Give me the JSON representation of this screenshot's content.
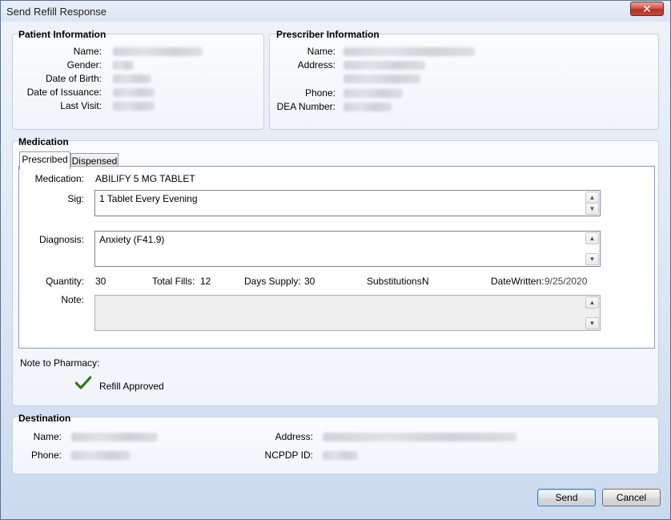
{
  "window": {
    "title": "Send Refill Response",
    "close_glyph": "✕"
  },
  "patient": {
    "section_title": "Patient Information",
    "labels": {
      "name": "Name:",
      "gender": "Gender:",
      "dob": "Date of Birth:",
      "issuance": "Date of Issuance:",
      "last_visit": "Last Visit:"
    }
  },
  "prescriber": {
    "section_title": "Prescriber Information",
    "labels": {
      "name": "Name:",
      "address": "Address:",
      "phone": "Phone:",
      "dea": "DEA Number:"
    }
  },
  "medication": {
    "section_title": "Medication",
    "tabs": [
      "Prescribed",
      "Dispensed"
    ],
    "active_tab": "Prescribed",
    "labels": {
      "medication": "Medication:",
      "sig": "Sig:",
      "diagnosis": "Diagnosis:",
      "quantity": "Quantity:",
      "total_fills": "Total Fills:",
      "days_supply": "Days Supply:",
      "substitutions": "Substitutions:",
      "date_written": "DateWritten:",
      "note": "Note:"
    },
    "values": {
      "medication": "ABILIFY 5 MG TABLET",
      "sig": "1 Tablet Every Evening",
      "diagnosis": "Anxiety (F41.9)",
      "quantity": "30",
      "total_fills": "12",
      "days_supply": "30",
      "substitutions": "N",
      "date_written": "9/25/2020",
      "note": ""
    }
  },
  "pharmacy_note": {
    "label": "Note to Pharmacy:",
    "status": "Refill Approved",
    "status_icon": "check-icon",
    "status_color": "#2f7a1e"
  },
  "destination": {
    "section_title": "Destination",
    "labels": {
      "name": "Name:",
      "phone": "Phone:",
      "address": "Address:",
      "ncpdp": "NCPDP ID:"
    }
  },
  "buttons": {
    "send": "Send",
    "cancel": "Cancel"
  }
}
